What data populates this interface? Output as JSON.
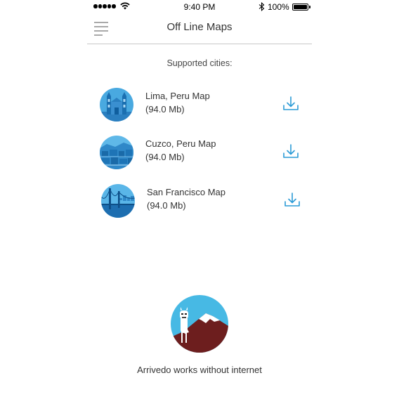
{
  "status_bar": {
    "time": "9:40 PM",
    "battery": "100%",
    "icons": [
      "signal-dots-icon",
      "wifi-icon",
      "bluetooth-icon",
      "battery-icon"
    ]
  },
  "header": {
    "title": "Off Line Maps",
    "menu_icon": "hamburger-menu-icon"
  },
  "section_title": "Supported cities:",
  "cities": [
    {
      "name": "Lima, Peru Map",
      "size": "(94.0 Mb)",
      "thumbnail": "lima-cathedral-thumbnail",
      "action_icon": "download-icon"
    },
    {
      "name": "Cuzco, Peru Map",
      "size": "(94.0 Mb)",
      "thumbnail": "cuzco-city-thumbnail",
      "action_icon": "download-icon"
    },
    {
      "name": "San Francisco Map",
      "size": "(94.0 Mb)",
      "thumbnail": "golden-gate-thumbnail",
      "action_icon": "download-icon"
    }
  ],
  "footer": {
    "illustration": "llama-mountain-illustration",
    "text": "Arrivedo works without internet"
  },
  "colors": {
    "accent_blue": "#2b9bd6",
    "thumb_blue": "#1f8fd0",
    "sky_blue": "#47b9e4",
    "mountain_brown": "#6d1e1e",
    "divider": "#c8c8c8"
  }
}
